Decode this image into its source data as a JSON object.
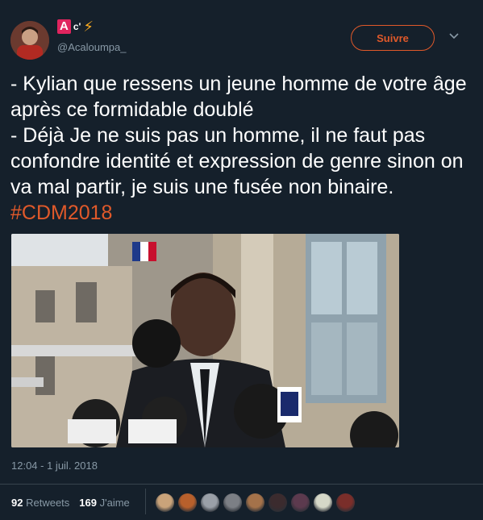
{
  "user": {
    "badge_letter": "A",
    "badge_suffix": "c'",
    "handle": "@Acaloumpa_"
  },
  "follow_label": "Suivre",
  "tweet": {
    "line1": "- Kylian que ressens un jeune homme de votre âge après ce formidable doublé",
    "line2": "- Déjà Je ne suis pas un homme, il ne faut pas confondre identité et expression de genre sinon on va mal partir, je suis une fusée non binaire.",
    "hashtag": "#CDM2018"
  },
  "timestamp": "12:04 - 1 juil. 2018",
  "stats": {
    "retweets_count": "92",
    "retweets_label": "Retweets",
    "likes_count": "169",
    "likes_label": "J'aime"
  },
  "colors": {
    "background": "#15202b",
    "accent": "#e0592a",
    "muted": "#8899a6",
    "badge": "#e0245e",
    "bolt": "#ffad1f"
  },
  "icons": {
    "bolt": "high-voltage-icon",
    "chevron": "chevron-down-icon"
  },
  "likers": [
    {
      "color": "#c9a37a"
    },
    {
      "color": "#b8602c"
    },
    {
      "color": "#9aa0a8"
    },
    {
      "color": "#7c7f85"
    },
    {
      "color": "#a4724a"
    },
    {
      "color": "#3b2b2e"
    },
    {
      "color": "#5c3a4e"
    },
    {
      "color": "#d5d8c8"
    },
    {
      "color": "#7a2e2a"
    }
  ]
}
